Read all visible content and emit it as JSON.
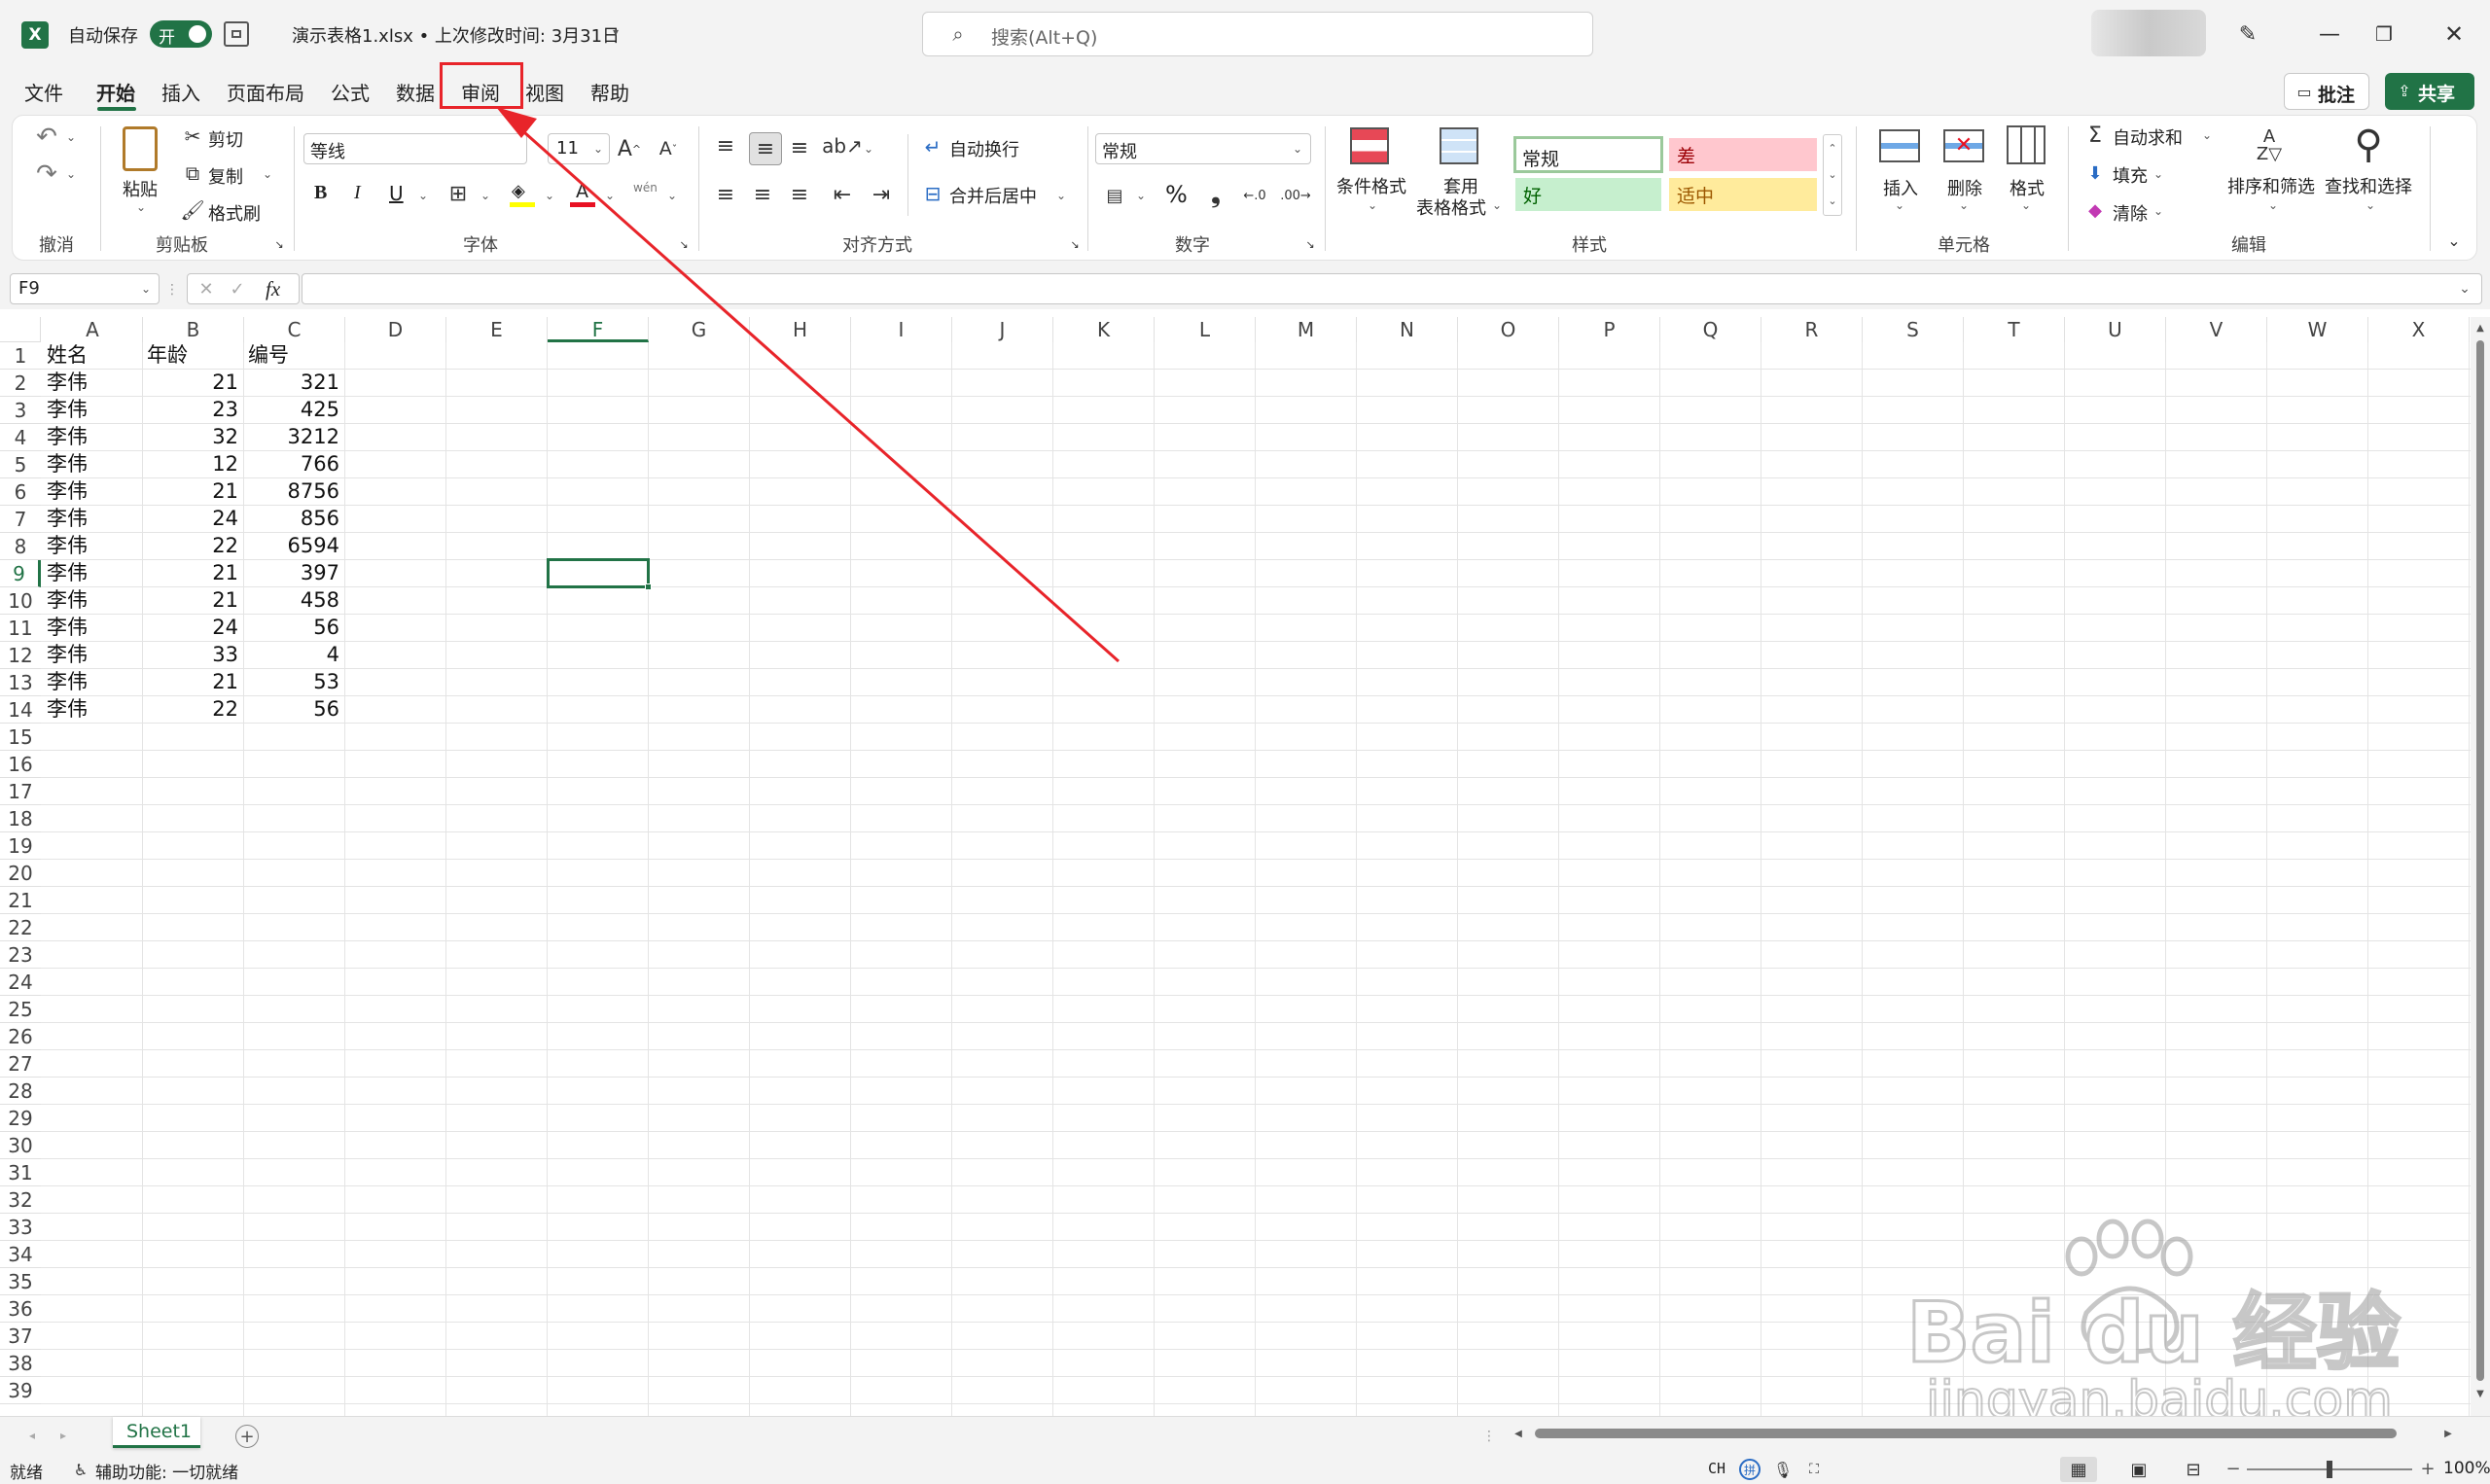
{
  "titlebar": {
    "autosave_label": "自动保存",
    "autosave_toggle": "开",
    "doc_title": "演示表格1.xlsx • 上次修改时间: 3月31日 ",
    "search_placeholder": "搜索(Alt+Q)"
  },
  "menu": {
    "tabs": [
      "文件",
      "开始",
      "插入",
      "页面布局",
      "公式",
      "数据",
      "审阅",
      "视图",
      "帮助"
    ],
    "active": "开始",
    "highlighted": "审阅",
    "comment_button": "批注",
    "share_button": "共享"
  },
  "ribbon": {
    "undo_group": "撤消",
    "clipboard": {
      "paste": "粘贴",
      "cut": "剪切",
      "copy": "复制",
      "format_painter": "格式刷",
      "group": "剪贴板"
    },
    "font": {
      "name": "等线",
      "size": "11",
      "bold": "B",
      "italic": "I",
      "underline": "U",
      "phonetic": "wén",
      "group": "字体"
    },
    "alignment": {
      "wrap": "自动换行",
      "merge": "合并后居中",
      "group": "对齐方式"
    },
    "number": {
      "format": "常规",
      "percent": "%",
      "group": "数字"
    },
    "styles": {
      "conditional": "条件格式",
      "table_format_1": "套用",
      "table_format_2": "表格格式",
      "normal": "常规",
      "bad": "差",
      "good": "好",
      "neutral": "适中",
      "group": "样式"
    },
    "cells": {
      "insert": "插入",
      "delete": "删除",
      "format": "格式",
      "group": "单元格"
    },
    "editing": {
      "autosum": "自动求和",
      "fill": "填充",
      "clear": "清除",
      "sort": "排序和筛选",
      "find": "查找和选择",
      "group": "编辑"
    }
  },
  "formula_bar": {
    "name_box": "F9",
    "fx": "fx",
    "value": ""
  },
  "sheet": {
    "columns": [
      "A",
      "B",
      "C",
      "D",
      "E",
      "F",
      "G",
      "H",
      "I",
      "J",
      "K",
      "L",
      "M",
      "N",
      "O",
      "P",
      "Q",
      "R",
      "S",
      "T",
      "U",
      "V",
      "W",
      "X"
    ],
    "row_count": 39,
    "headers": [
      "姓名",
      "年龄",
      "编号"
    ],
    "rows": [
      [
        "李伟",
        "21",
        "321"
      ],
      [
        "李伟",
        "23",
        "425"
      ],
      [
        "李伟",
        "32",
        "3212"
      ],
      [
        "李伟",
        "12",
        "766"
      ],
      [
        "李伟",
        "21",
        "8756"
      ],
      [
        "李伟",
        "24",
        "856"
      ],
      [
        "李伟",
        "22",
        "6594"
      ],
      [
        "李伟",
        "21",
        "397"
      ],
      [
        "李伟",
        "21",
        "458"
      ],
      [
        "李伟",
        "24",
        "56"
      ],
      [
        "李伟",
        "33",
        "4"
      ],
      [
        "李伟",
        "21",
        "53"
      ],
      [
        "李伟",
        "22",
        "56"
      ]
    ],
    "selected_cell": "F9",
    "tab_name": "Sheet1"
  },
  "status": {
    "ready": "就绪",
    "accessibility": "辅助功能: 一切就绪",
    "ime": "CH",
    "zoom": "100%"
  },
  "watermark": {
    "line1": "Bai du 经验",
    "line2": "jingyan.baidu.com"
  },
  "colors": {
    "excel_green": "#217346",
    "annotation_red": "#e8242a"
  }
}
